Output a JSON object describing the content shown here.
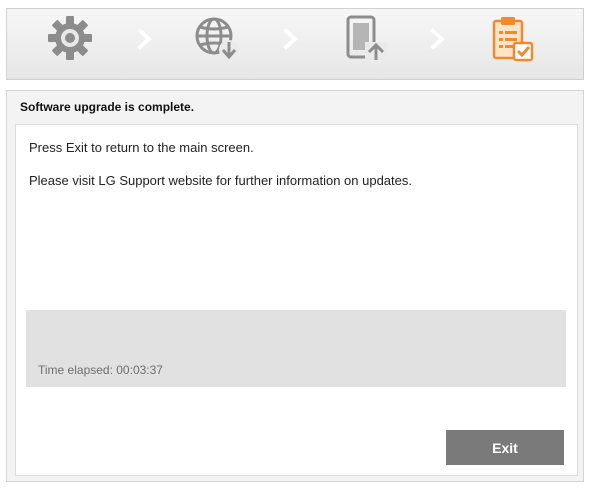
{
  "steps": {
    "icons": [
      "gear-icon",
      "globe-download-icon",
      "device-upload-icon",
      "clipboard-check-icon"
    ],
    "active_index": 3,
    "active_color": "#f08a30",
    "inactive_color": "#8a8a8a"
  },
  "panel": {
    "title": "Software upgrade is complete."
  },
  "message": {
    "line1": "Press  Exit to return to the main screen.",
    "line2": "Please visit LG Support website for further information on updates."
  },
  "progress": {
    "elapsed_label": "Time elapsed: 00:03:37"
  },
  "actions": {
    "exit_label": "Exit"
  }
}
